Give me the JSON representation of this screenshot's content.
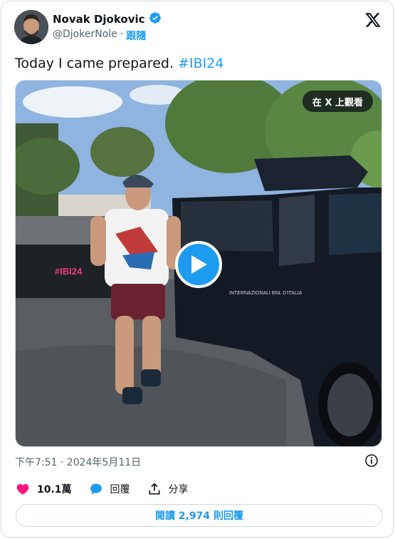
{
  "author": {
    "display_name": "Novak Djokovic",
    "handle": "@DjokerNole",
    "separator": "·",
    "follow_label": "跟隨",
    "verified": true
  },
  "tweet": {
    "text": "Today I came prepared.",
    "hashtag": "#IBI24"
  },
  "media": {
    "view_on_x_label": "在 X 上觀看",
    "banner_text": "#IBI24",
    "sponsor_text": "INTERNAZIONALI BNL D'ITALIA"
  },
  "meta": {
    "timestamp": "下午7:51 · 2024年5月11日"
  },
  "actions": {
    "likes_count": "10.1萬",
    "reply_label": "回覆",
    "share_label": "分享"
  },
  "footer": {
    "read_replies_label": "閱讀 2,974 則回覆"
  },
  "colors": {
    "accent": "#1d9bf0",
    "like": "#f91880",
    "text": "#0f1419",
    "muted": "#536471",
    "border": "#cfd9de"
  }
}
